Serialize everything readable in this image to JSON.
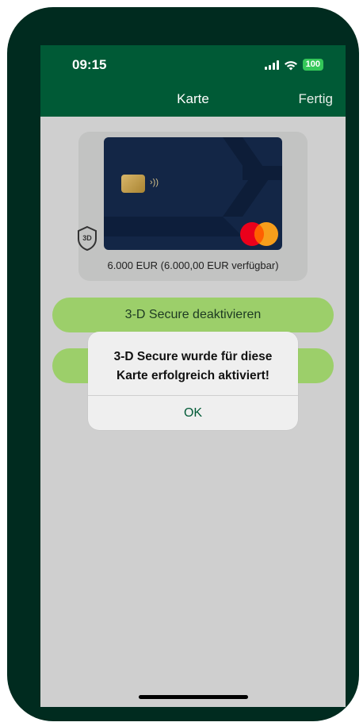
{
  "status_bar": {
    "time": "09:15",
    "battery": "100",
    "icons": [
      "signal-icon",
      "wifi-icon",
      "battery-icon"
    ]
  },
  "nav": {
    "title": "Karte",
    "done_label": "Fertig"
  },
  "card": {
    "limit_text": "6.000 EUR (6.000,00 EUR verfügbar)",
    "nfc_glyph": "›))",
    "shield_text": "3D",
    "brand_colors": {
      "red": "#eb001b",
      "orange": "#f79e1b",
      "card_bg": "#132646"
    }
  },
  "buttons": {
    "deactivate_label": "3-D Secure deaktivieren",
    "second_label": ""
  },
  "dialog": {
    "message_line1": "3-D Secure wurde für diese",
    "message_line2": "Karte erfolgreich aktiviert!",
    "ok_label": "OK"
  },
  "colors": {
    "header": "#005a36",
    "button": "#9ccf6a",
    "overlay_bg": "#cfcfcf",
    "phone_frame": "#002b1f"
  }
}
